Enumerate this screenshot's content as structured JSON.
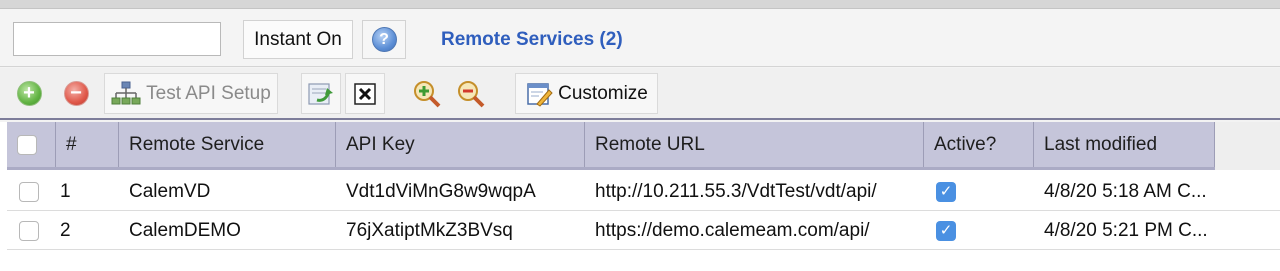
{
  "search": {
    "value": "",
    "placeholder": ""
  },
  "toolbar_top": {
    "instant_on_label": "Instant On",
    "help_icon_glyph": "?",
    "title": "Remote Services (2)"
  },
  "toolbar": {
    "add_icon": "+",
    "remove_icon": "−",
    "test_api_label": "Test API Setup",
    "customize_label": "Customize"
  },
  "table": {
    "columns": [
      "#",
      "Remote Service",
      "API Key",
      "Remote URL",
      "Active?",
      "Last modified"
    ],
    "rows": [
      {
        "num": "1",
        "service": "CalemVD",
        "api_key": "Vdt1dViMnG8w9wqpA",
        "url": "http://10.211.55.3/VdtTest/vdt/api/",
        "active": "✓",
        "modified": "4/8/20 5:18 AM C..."
      },
      {
        "num": "2",
        "service": "CalemDEMO",
        "api_key": "76jXatiptMkZ3BVsq",
        "url": "https://demo.calemeam.com/api/",
        "active": "✓",
        "modified": "4/8/20 5:21 PM C..."
      }
    ]
  },
  "colors": {
    "title": "#2f5ebd",
    "header_bg": "#c5c5da",
    "check": "#4a90e2"
  }
}
